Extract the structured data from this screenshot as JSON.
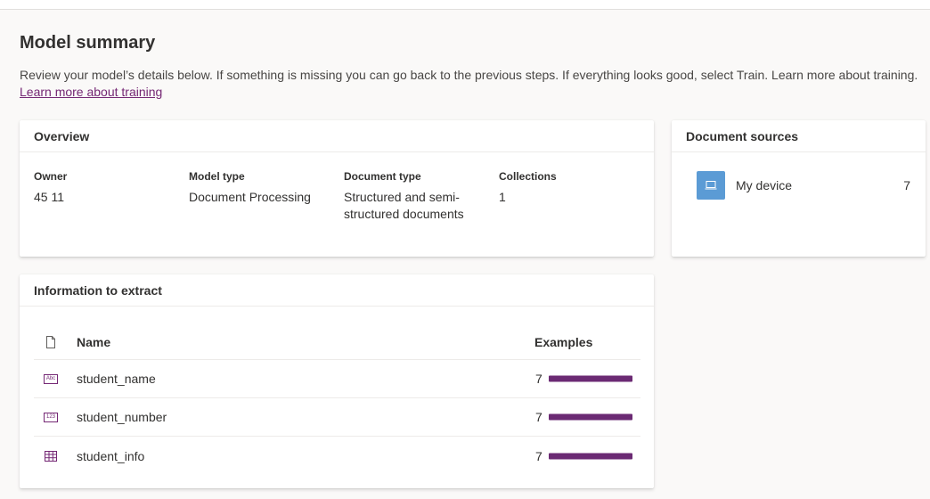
{
  "page": {
    "title": "Model summary",
    "intro": "Review your model’s details below. If something is missing you can go back to the previous steps. If everything looks good, select Train. Learn more about training.",
    "intro_link": "Learn more about training"
  },
  "overview": {
    "title": "Overview",
    "fields": [
      {
        "label": "Owner",
        "value": "45 11"
      },
      {
        "label": "Model type",
        "value": "Document Processing"
      },
      {
        "label": "Document type",
        "value": "Structured and semi-structured documents"
      },
      {
        "label": "Collections",
        "value": "1"
      }
    ]
  },
  "sources": {
    "title": "Document sources",
    "items": [
      {
        "name": "My device",
        "count": "7",
        "icon": "laptop-icon"
      }
    ]
  },
  "extract": {
    "title": "Information to extract",
    "headers": {
      "name": "Name",
      "examples": "Examples"
    },
    "rows": [
      {
        "name": "student_name",
        "count": "7",
        "icon": "text-field-icon",
        "icon_text": "Abc",
        "fill": 1.0
      },
      {
        "name": "student_number",
        "count": "7",
        "icon": "number-field-icon",
        "icon_text": "123",
        "fill": 1.0
      },
      {
        "name": "student_info",
        "count": "7",
        "icon": "table-icon",
        "fill": 1.0
      }
    ]
  },
  "colors": {
    "accent": "#742774",
    "bar": "#6b2a73",
    "source_icon_bg": "#5b9bd5"
  }
}
